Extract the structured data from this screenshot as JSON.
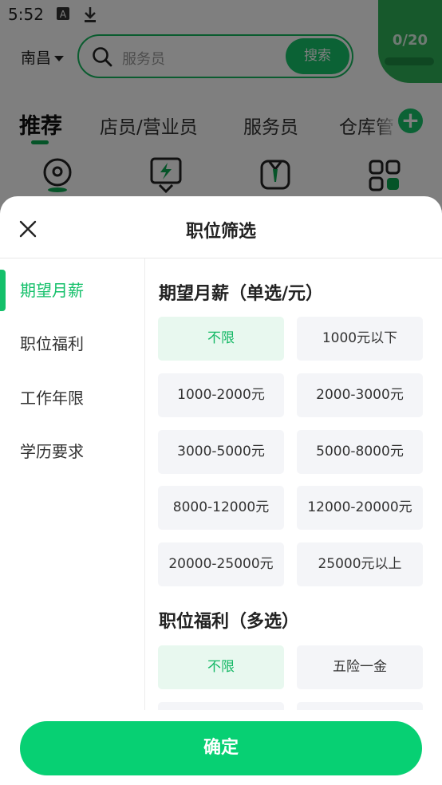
{
  "status_bar": {
    "time": "5:52"
  },
  "header": {
    "city": "南昌",
    "search_placeholder": "服务员",
    "search_button": "搜索",
    "counter": "0/20"
  },
  "tabs": [
    {
      "label": "推荐"
    },
    {
      "label": "店员/营业员"
    },
    {
      "label": "服务员"
    },
    {
      "label": "仓库管"
    }
  ],
  "sheet": {
    "title": "职位筛选",
    "confirm": "确定",
    "sidebar": [
      {
        "label": "期望月薪"
      },
      {
        "label": "职位福利"
      },
      {
        "label": "工作年限"
      },
      {
        "label": "学历要求"
      }
    ],
    "salary": {
      "title": "期望月薪（单选/元）",
      "options": [
        {
          "label": "不限"
        },
        {
          "label": "1000元以下"
        },
        {
          "label": "1000-2000元"
        },
        {
          "label": "2000-3000元"
        },
        {
          "label": "3000-5000元"
        },
        {
          "label": "5000-8000元"
        },
        {
          "label": "8000-12000元"
        },
        {
          "label": "12000-20000元"
        },
        {
          "label": "20000-25000元"
        },
        {
          "label": "25000元以上"
        }
      ]
    },
    "benefits": {
      "title": "职位福利（多选）",
      "options": [
        {
          "label": "不限"
        },
        {
          "label": "五险一金"
        }
      ]
    }
  },
  "colors": {
    "accent": "#14c06a",
    "confirm": "#07d073",
    "selected_bg": "#e8f8ef"
  }
}
